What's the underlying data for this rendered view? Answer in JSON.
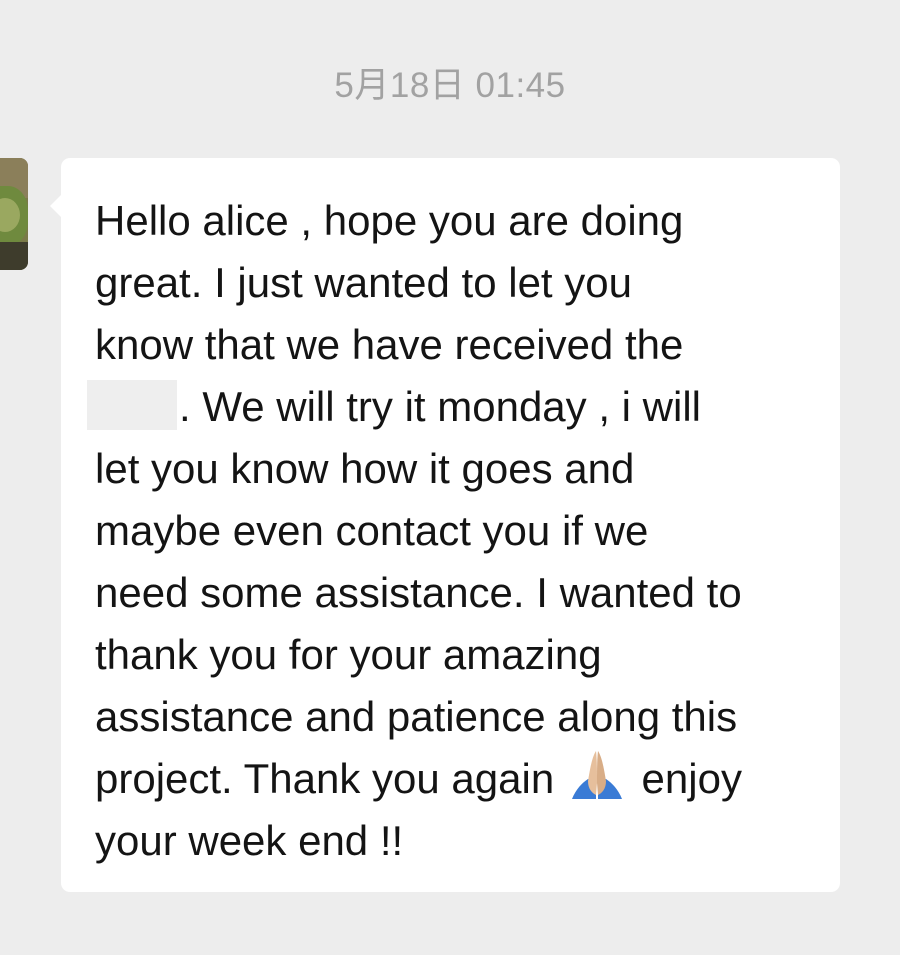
{
  "chat": {
    "timestamp": "5月18日 01:45",
    "message": {
      "lines": [
        "Hello alice , hope you are doing",
        "great. I just wanted to let you",
        "know that we have received the",
        ". We will try it monday , i will",
        "let you know how it goes and",
        "maybe even contact you if we",
        "need some assistance. I wanted to",
        "thank you for your amazing",
        "assistance and patience along this",
        "project. Thank you again",
        "enjoy",
        "your week end !!"
      ],
      "emoji": "folded-hands-emoji"
    }
  },
  "colors": {
    "background": "#ededed",
    "bubble": "#ffffff",
    "timestamp": "#a2a2a2",
    "text": "#141414"
  }
}
